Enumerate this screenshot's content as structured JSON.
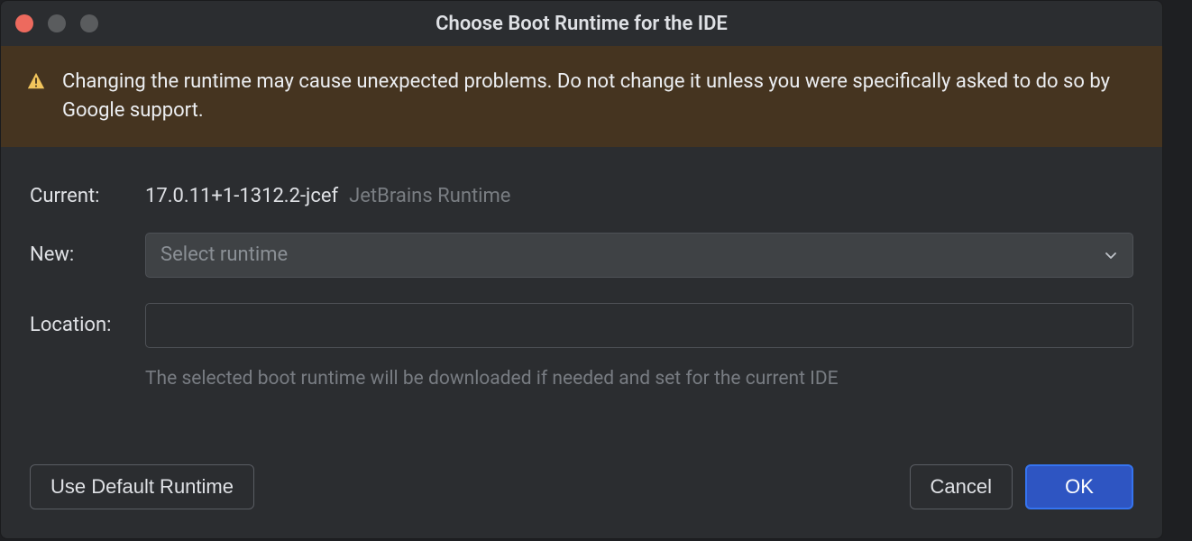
{
  "dialog": {
    "title": "Choose Boot Runtime for the IDE"
  },
  "banner": {
    "icon": "warning-icon",
    "text": "Changing the runtime may cause unexpected problems. Do not change it unless you were specifically asked to do so by Google support."
  },
  "fields": {
    "current_label": "Current:",
    "current_value": "17.0.11+1-1312.2-jcef",
    "current_vendor": "JetBrains Runtime",
    "new_label": "New:",
    "new_placeholder": "Select runtime",
    "location_label": "Location:",
    "location_value": "",
    "hint": "The selected boot runtime will be downloaded if needed and set for the current IDE"
  },
  "buttons": {
    "use_default": "Use Default Runtime",
    "cancel": "Cancel",
    "ok": "OK"
  }
}
